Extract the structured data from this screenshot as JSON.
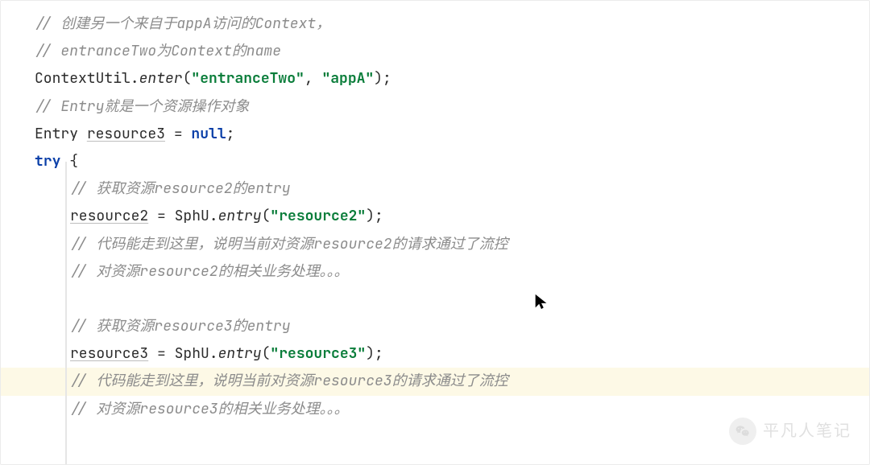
{
  "code": {
    "c1": "// 创建另一个来自于appA访问的Context，",
    "c2": "// entranceTwo为Context的name",
    "l3_a": "ContextUtil.",
    "l3_m": "enter",
    "l3_b": "(",
    "l3_s1": "\"entranceTwo\"",
    "l3_c": ", ",
    "l3_s2": "\"appA\"",
    "l3_d": ");",
    "c4": "// Entry就是一个资源操作对象",
    "l5_a": "Entry ",
    "l5_u": "resource3",
    "l5_b": " = ",
    "l5_k": "null",
    "l5_c": ";",
    "l6_k": "try",
    "l6_a": " {",
    "c7": "// 获取资源resource2的entry",
    "l8_u": "resource2",
    "l8_a": " = SphU.",
    "l8_m": "entry",
    "l8_b": "(",
    "l8_s": "\"resource2\"",
    "l8_c": ");",
    "c9": "// 代码能走到这里，说明当前对资源resource2的请求通过了流控",
    "c10": "// 对资源resource2的相关业务处理。。。",
    "c12": "// 获取资源resource3的entry",
    "l13_u": "resource3",
    "l13_a": " = SphU.",
    "l13_m": "entry",
    "l13_b": "(",
    "l13_s": "\"resource3\"",
    "l13_c": ");",
    "c14": "// 代码能走到这里，说明当前对资源resource3的请求通过了流控",
    "c15": "// 对资源resource3的相关业务处理。。。"
  },
  "watermark": {
    "text": "平凡人笔记"
  }
}
